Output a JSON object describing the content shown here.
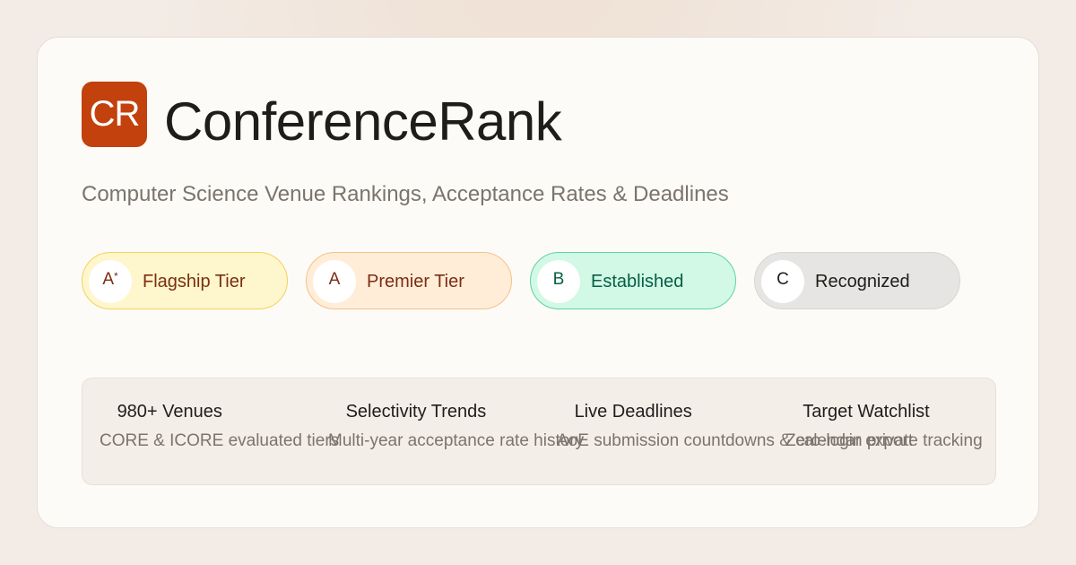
{
  "brand": {
    "logo_text": "CR",
    "name": "ConferenceRank",
    "tagline": "Computer Science Venue Rankings, Acceptance Rates & Deadlines"
  },
  "colors": {
    "accent": "#c2410c",
    "tier_astar_bg": "#fef6cc",
    "tier_a_bg": "#ffedd8",
    "tier_b_bg": "#d2f8e6",
    "tier_c_bg": "#e6e5e3"
  },
  "tiers": [
    {
      "code": "A",
      "sup": "*",
      "label": "Flagship Tier"
    },
    {
      "code": "A",
      "sup": "",
      "label": "Premier Tier"
    },
    {
      "code": "B",
      "sup": "",
      "label": "Established"
    },
    {
      "code": "C",
      "sup": "",
      "label": "Recognized"
    }
  ],
  "features": [
    {
      "icon": "",
      "title": "980+ Venues",
      "description": "CORE & ICORE evaluated tiers"
    },
    {
      "icon": "",
      "title": "Selectivity Trends",
      "description": "Multi-year acceptance rate history"
    },
    {
      "icon": "",
      "title": "Live Deadlines",
      "description": "AoE submission countdowns & calendar export"
    },
    {
      "icon": "",
      "title": "Target Watchlist",
      "description": "Zero-login private tracking"
    }
  ]
}
